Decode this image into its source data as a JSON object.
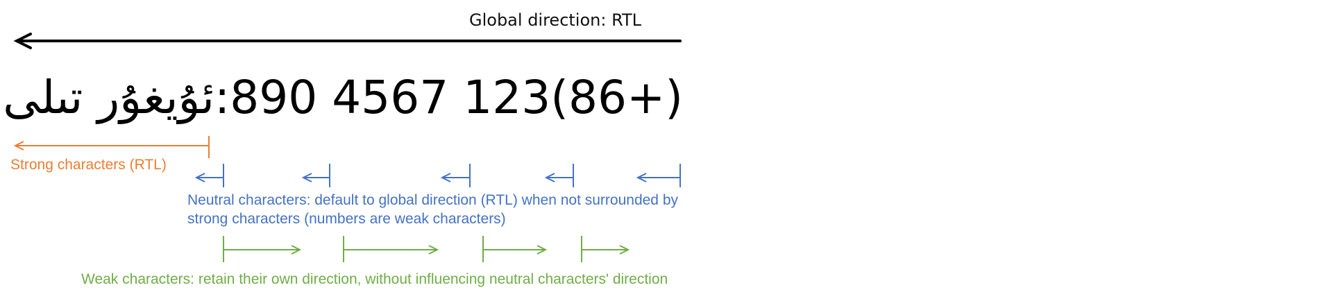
{
  "global_direction": {
    "label": "Global direction: RTL"
  },
  "sample_text": "(+86)123 4567 890:ئۇيغۇر تىلى",
  "legend": {
    "strong": {
      "label": "Strong characters (RTL)",
      "color": "#ED7D31"
    },
    "neutral": {
      "label_line1": "Neutral characters: default to global direction (RTL) when not surrounded by",
      "label_line2": "strong characters (numbers are weak characters)",
      "color": "#4472C4"
    },
    "weak": {
      "label": "Weak characters: retain their own direction, without influencing neutral characters' direction",
      "color": "#70AD47"
    }
  }
}
